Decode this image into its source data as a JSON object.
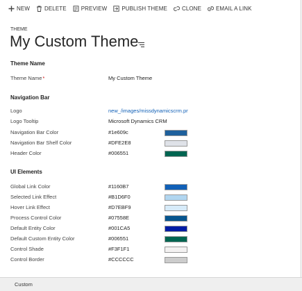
{
  "toolbar": {
    "items": [
      {
        "label": "NEW",
        "icon": "plus-icon"
      },
      {
        "label": "DELETE",
        "icon": "trash-icon"
      },
      {
        "label": "PREVIEW",
        "icon": "preview-icon"
      },
      {
        "label": "PUBLISH THEME",
        "icon": "publish-icon"
      },
      {
        "label": "CLONE",
        "icon": "clone-icon"
      },
      {
        "label": "EMAIL A LINK",
        "icon": "email-link-icon"
      }
    ]
  },
  "header": {
    "entity": "THEME",
    "title": "My Custom Theme"
  },
  "sections": {
    "theme_name": {
      "title": "Theme Name",
      "theme_name_label": "Theme Name",
      "required_marker": "*",
      "theme_name_value": "My Custom Theme"
    },
    "navigation_bar": {
      "title": "Navigation Bar",
      "logo_label": "Logo",
      "logo_value": "new_/images/missdynamicscrm.png",
      "logo_tooltip_label": "Logo Tooltip",
      "logo_tooltip_value": "Microsoft Dynamics CRM",
      "nav_bar_color_label": "Navigation Bar Color",
      "nav_bar_color_value": "#1e609c",
      "nav_bar_shelf_label": "Navigation Bar Shelf Color",
      "nav_bar_shelf_value": "#DFE2E8",
      "header_color_label": "Header Color",
      "header_color_value": "#006551"
    },
    "ui_elements": {
      "title": "UI Elements",
      "global_link_label": "Global Link Color",
      "global_link_value": "#1160B7",
      "selected_link_label": "Selected Link Effect",
      "selected_link_value": "#B1D6F0",
      "hover_link_label": "Hover Link Effect",
      "hover_link_value": "#D7EBF9",
      "process_control_label": "Process Control Color",
      "process_control_value": "#07558E",
      "default_entity_label": "Default Entity Color",
      "default_entity_value": "#001CA5",
      "default_custom_entity_label": "Default Custom Entity Color",
      "default_custom_entity_value": "#006551",
      "control_shade_label": "Control Shade",
      "control_shade_value": "#F3F1F1",
      "control_border_label": "Control Border",
      "control_border_value": "#CCCCCC"
    }
  },
  "footer": {
    "label": "Custom"
  }
}
